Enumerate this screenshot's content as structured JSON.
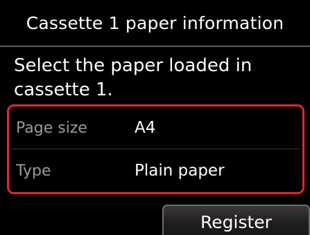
{
  "header": {
    "title": "Cassette 1 paper information"
  },
  "instruction": {
    "text": "Select the paper loaded in cassette 1."
  },
  "settings": {
    "items": [
      {
        "label": "Page size",
        "value": "A4"
      },
      {
        "label": "Type",
        "value": "Plain paper"
      }
    ],
    "highlight_color": "#e8242c"
  },
  "actions": {
    "register_label": "Register"
  }
}
